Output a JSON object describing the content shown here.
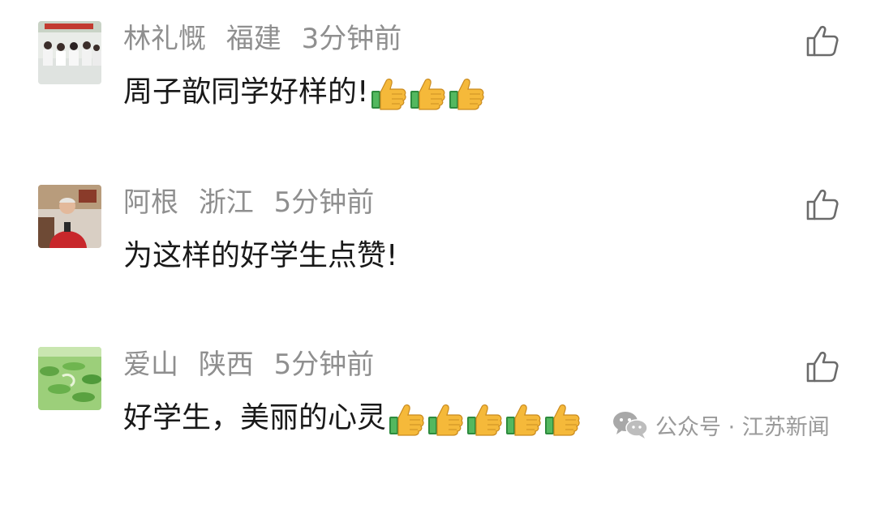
{
  "comments": [
    {
      "name": "林礼慨",
      "location": "福建",
      "time": "3分钟前",
      "text": "周子歆同学好样的!",
      "thumbs_count": 3,
      "avatar_icon": "classroom-photo"
    },
    {
      "name": "阿根",
      "location": "浙江",
      "time": "5分钟前",
      "text": "为这样的好学生点赞!",
      "thumbs_count": 0,
      "avatar_icon": "man-portrait-photo"
    },
    {
      "name": "爱山",
      "location": "陕西",
      "time": "5分钟前",
      "text": "好学生，美丽的心灵",
      "thumbs_count": 5,
      "avatar_icon": "lotus-pond-photo"
    }
  ],
  "watermark": {
    "icon": "wechat-icon",
    "text": "公众号 · 江苏新闻"
  },
  "colors": {
    "meta_text": "#8f8f8f",
    "body_text": "#191919",
    "icon_stroke": "#6b6b6b",
    "watermark": "#9a9a9a"
  }
}
